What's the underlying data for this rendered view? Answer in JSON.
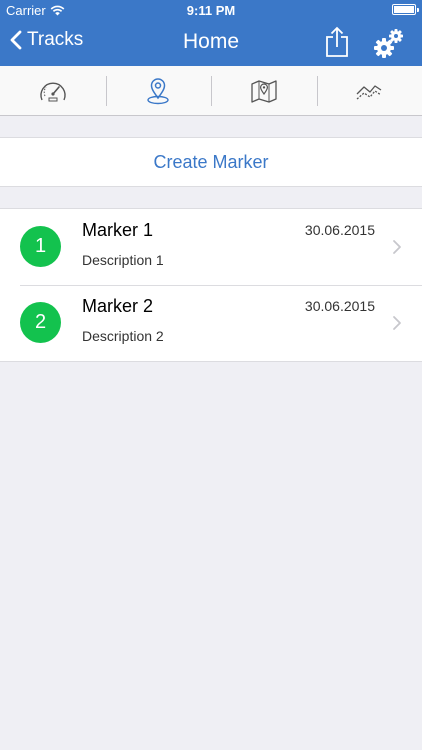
{
  "status_bar": {
    "carrier": "Carrier",
    "time": "9:11 PM"
  },
  "nav": {
    "back_label": "Tracks",
    "title": "Home"
  },
  "tabs": [
    {
      "icon": "speedometer-icon",
      "selected": false
    },
    {
      "icon": "location-pin-icon",
      "selected": true
    },
    {
      "icon": "map-icon",
      "selected": false
    },
    {
      "icon": "chart-icon",
      "selected": false
    }
  ],
  "create_marker_label": "Create Marker",
  "markers": [
    {
      "badge": "1",
      "name": "Marker 1",
      "description": "Description 1",
      "date": "30.06.2015"
    },
    {
      "badge": "2",
      "name": "Marker 2",
      "description": "Description 2",
      "date": "30.06.2015"
    }
  ],
  "colors": {
    "accent": "#3b78c8",
    "badge": "#13c24e",
    "background": "#efeff4"
  }
}
